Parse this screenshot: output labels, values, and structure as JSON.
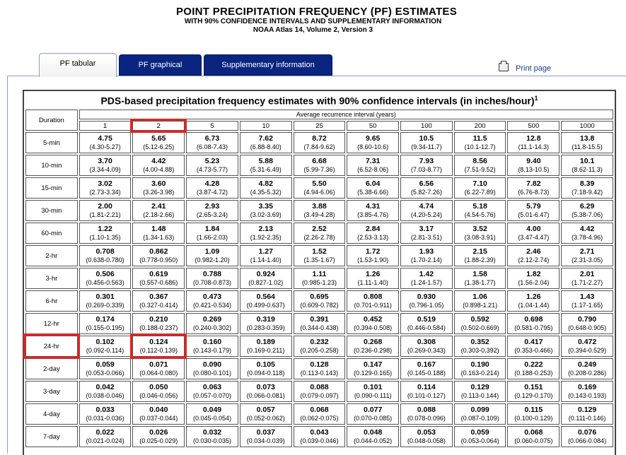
{
  "header": {
    "title": "POINT PRECIPITATION FREQUENCY (PF) ESTIMATES",
    "subtitle1": "WITH 90% CONFIDENCE INTERVALS AND SUPPLEMENTARY INFORMATION",
    "subtitle2": "NOAA Atlas 14, Volume 2, Version 3"
  },
  "tabs": [
    {
      "label": "PF tabular",
      "active": true
    },
    {
      "label": "PF graphical",
      "active": false
    },
    {
      "label": "Supplementary information",
      "active": false
    }
  ],
  "print_label": "Print page",
  "table": {
    "title": "PDS-based precipitation frequency estimates with 90% confidence intervals (in inches/hour)",
    "title_sup": "1",
    "duration_label": "Duration",
    "ari_label": "Average recurrence interval (years)",
    "columns": [
      "1",
      "2",
      "5",
      "10",
      "25",
      "50",
      "100",
      "200",
      "500",
      "1000"
    ],
    "rows": [
      {
        "label": "5-min",
        "values": [
          "4.75",
          "5.65",
          "6.73",
          "7.62",
          "8.72",
          "9.65",
          "10.5",
          "11.5",
          "12.8",
          "13.8"
        ],
        "ci": [
          "(4.30-5.27)",
          "(5.12-6.25)",
          "(6.08-7.43)",
          "(6.88-8.40)",
          "(7.84-9.62)",
          "(8.60-10.6)",
          "(9.34-11.7)",
          "(10.1-12.7)",
          "(11.1-14.3)",
          "(11.8-15.5)"
        ]
      },
      {
        "label": "10-min",
        "values": [
          "3.70",
          "4.42",
          "5.23",
          "5.88",
          "6.68",
          "7.31",
          "7.93",
          "8.56",
          "9.40",
          "10.1"
        ],
        "ci": [
          "(3.34-4.09)",
          "(4.00-4.88)",
          "(4.73-5.77)",
          "(5.31-6.49)",
          "(5.99-7.36)",
          "(6.52-8.06)",
          "(7.03-8.77)",
          "(7.51-9.52)",
          "(8.13-10.5)",
          "(8.62-11.3)"
        ]
      },
      {
        "label": "15-min",
        "values": [
          "3.02",
          "3.60",
          "4.28",
          "4.82",
          "5.50",
          "6.04",
          "6.56",
          "7.10",
          "7.82",
          "8.39"
        ],
        "ci": [
          "(2.73-3.34)",
          "(3.26-3.98)",
          "(3.87-4.72)",
          "(4.35-5.32)",
          "(4.94-6.06)",
          "(5.38-6.66)",
          "(5.82-7.26)",
          "(6.22-7.89)",
          "(6.76-8.73)",
          "(7.18-9.42)"
        ]
      },
      {
        "label": "30-min",
        "values": [
          "2.00",
          "2.41",
          "2.93",
          "3.35",
          "3.88",
          "4.31",
          "4.74",
          "5.18",
          "5.79",
          "6.29"
        ],
        "ci": [
          "(1.81-2.21)",
          "(2.18-2.66)",
          "(2.65-3.24)",
          "(3.02-3.69)",
          "(3.49-4.28)",
          "(3.85-4.76)",
          "(4.20-5.24)",
          "(4.54-5.76)",
          "(5.01-6.47)",
          "(5.38-7.06)"
        ]
      },
      {
        "label": "60-min",
        "values": [
          "1.22",
          "1.48",
          "1.84",
          "2.13",
          "2.52",
          "2.84",
          "3.17",
          "3.52",
          "4.00",
          "4.42"
        ],
        "ci": [
          "(1.10-1.35)",
          "(1.34-1.63)",
          "(1.66-2.03)",
          "(1.92-2.35)",
          "(2.26-2.78)",
          "(2.53-3.13)",
          "(2.81-3.51)",
          "(3.08-3.91)",
          "(3.47-4.47)",
          "(3.78-4.96)"
        ]
      },
      {
        "label": "2-hr",
        "values": [
          "0.708",
          "0.862",
          "1.09",
          "1.27",
          "1.52",
          "1.72",
          "1.93",
          "2.15",
          "2.46",
          "2.71"
        ],
        "ci": [
          "(0.638-0.780)",
          "(0.778-0.950)",
          "(0.982-1.20)",
          "(1.14-1.40)",
          "(1.35-1.67)",
          "(1.53-1.90)",
          "(1.70-2.14)",
          "(1.88-2.39)",
          "(2.12-2.74)",
          "(2.31-3.05)"
        ]
      },
      {
        "label": "3-hr",
        "values": [
          "0.506",
          "0.619",
          "0.788",
          "0.924",
          "1.11",
          "1.26",
          "1.42",
          "1.58",
          "1.82",
          "2.01"
        ],
        "ci": [
          "(0.456-0.563)",
          "(0.557-0.686)",
          "(0.708-0.873)",
          "(0.827-1.02)",
          "(0.985-1.23)",
          "(1.11-1.40)",
          "(1.24-1.57)",
          "(1.38-1.77)",
          "(1.56-2.04)",
          "(1.71-2.27)"
        ]
      },
      {
        "label": "6-hr",
        "values": [
          "0.301",
          "0.367",
          "0.473",
          "0.564",
          "0.695",
          "0.808",
          "0.930",
          "1.06",
          "1.26",
          "1.43"
        ],
        "ci": [
          "(0.269-0.339)",
          "(0.327-0.414)",
          "(0.421-0.534)",
          "(0.499-0.637)",
          "(0.609-0.782)",
          "(0.701-0.911)",
          "(0.796-1.05)",
          "(0.898-1.21)",
          "(1.04-1.44)",
          "(1.17-1.65)"
        ]
      },
      {
        "label": "12-hr",
        "values": [
          "0.174",
          "0.210",
          "0.269",
          "0.319",
          "0.391",
          "0.452",
          "0.519",
          "0.592",
          "0.698",
          "0.790"
        ],
        "ci": [
          "(0.155-0.195)",
          "(0.188-0.237)",
          "(0.240-0.302)",
          "(0.283-0.359)",
          "(0.344-0.438)",
          "(0.394-0.508)",
          "(0.446-0.584)",
          "(0.502-0.669)",
          "(0.581-0.795)",
          "(0.648-0.905)"
        ]
      },
      {
        "label": "24-hr",
        "values": [
          "0.102",
          "0.124",
          "0.160",
          "0.189",
          "0.232",
          "0.268",
          "0.308",
          "0.352",
          "0.417",
          "0.472"
        ],
        "ci": [
          "(0.092-0.114)",
          "(0.112-0.139)",
          "(0.143-0.179)",
          "(0.169-0.211)",
          "(0.205-0.258)",
          "(0.236-0.298)",
          "(0.269-0.343)",
          "(0.303-0.392)",
          "(0.353-0.466)",
          "(0.394-0.529)"
        ]
      },
      {
        "label": "2-day",
        "values": [
          "0.059",
          "0.071",
          "0.090",
          "0.105",
          "0.128",
          "0.147",
          "0.167",
          "0.190",
          "0.222",
          "0.249"
        ],
        "ci": [
          "(0.053-0.066)",
          "(0.064-0.080)",
          "(0.080-0.101)",
          "(0.094-0.118)",
          "(0.113-0.143)",
          "(0.129-0.165)",
          "(0.145-0.188)",
          "(0.163-0.214)",
          "(0.188-0.253)",
          "(0.208-0.286)"
        ]
      },
      {
        "label": "3-day",
        "values": [
          "0.042",
          "0.050",
          "0.063",
          "0.073",
          "0.088",
          "0.101",
          "0.114",
          "0.129",
          "0.151",
          "0.169"
        ],
        "ci": [
          "(0.038-0.046)",
          "(0.046-0.056)",
          "(0.057-0.070)",
          "(0.066-0.081)",
          "(0.079-0.097)",
          "(0.090-0.111)",
          "(0.101-0.127)",
          "(0.113-0.144)",
          "(0.129-0.170)",
          "(0.143-0.193)"
        ]
      },
      {
        "label": "4-day",
        "values": [
          "0.033",
          "0.040",
          "0.049",
          "0.057",
          "0.068",
          "0.077",
          "0.088",
          "0.099",
          "0.115",
          "0.129"
        ],
        "ci": [
          "(0.031-0.036)",
          "(0.037-0.044)",
          "(0.045-0.054)",
          "(0.052-0.062)",
          "(0.062-0.075)",
          "(0.070-0.085)",
          "(0.078-0.096)",
          "(0.087-0.109)",
          "(0.100-0.129)",
          "(0.111-0.146)"
        ]
      },
      {
        "label": "7-day",
        "values": [
          "0.022",
          "0.026",
          "0.032",
          "0.037",
          "0.043",
          "0.048",
          "0.053",
          "0.059",
          "0.068",
          "0.076"
        ],
        "ci": [
          "(0.021-0.024)",
          "(0.025-0.029)",
          "(0.030-0.035)",
          "(0.034-0.039)",
          "(0.039-0.046)",
          "(0.044-0.052)",
          "(0.048-0.058)",
          "(0.053-0.064)",
          "(0.060-0.075)",
          "(0.066-0.084)"
        ]
      }
    ]
  },
  "highlights": {
    "column": "2",
    "row": "24-hr",
    "color": "#e8211b"
  }
}
